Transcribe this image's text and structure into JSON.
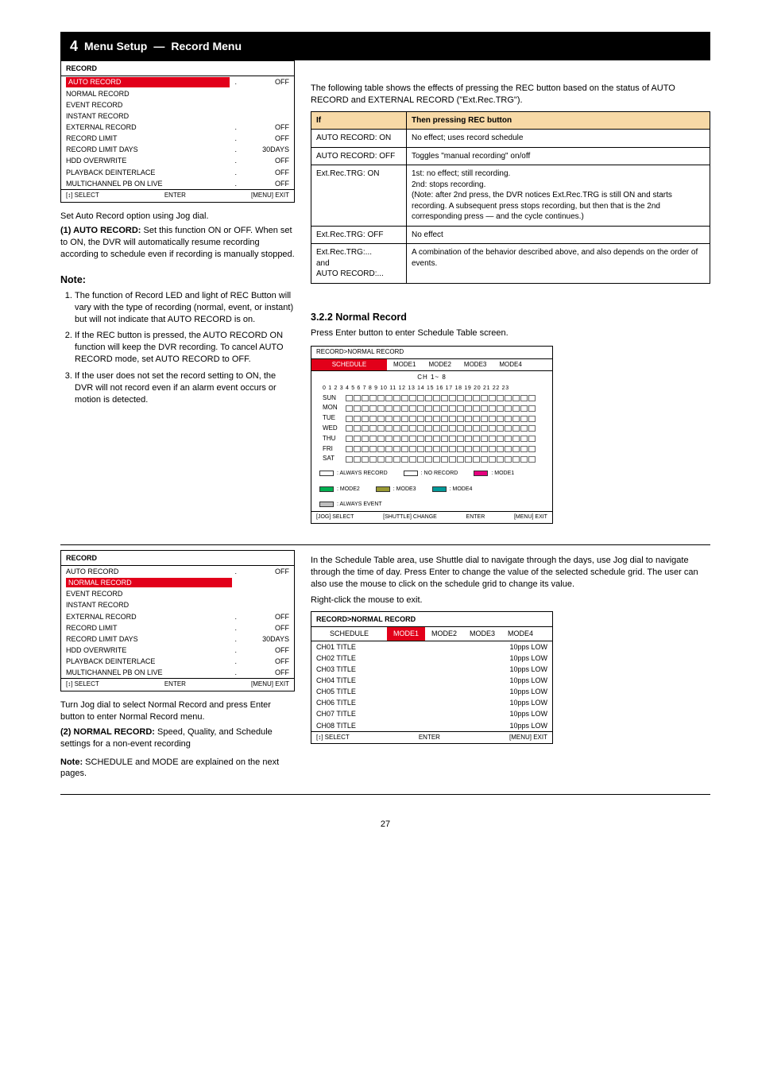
{
  "header": {
    "num": "4",
    "title": "Menu Setup",
    "sub": "Record Menu"
  },
  "autoMenu": {
    "title": "RECORD",
    "items": [
      {
        "label": "AUTO RECORD",
        "val": "OFF"
      },
      {
        "label": "NORMAL RECORD",
        "val": ""
      },
      {
        "label": "EVENT RECORD",
        "val": ""
      },
      {
        "label": "INSTANT RECORD",
        "val": ""
      },
      {
        "label": "EXTERNAL RECORD",
        "val": "OFF"
      },
      {
        "label": "RECORD LIMIT",
        "val": "OFF"
      },
      {
        "label": "RECORD LIMIT DAYS",
        "val": "30DAYS"
      },
      {
        "label": "HDD OVERWRITE",
        "val": "OFF"
      },
      {
        "label": "PLAYBACK DEINTERLACE",
        "val": "OFF"
      },
      {
        "label": "MULTICHANNEL PB ON LIVE",
        "val": "OFF"
      }
    ],
    "footer": {
      "sel": "[↕] SELECT",
      "enter": "ENTER",
      "exit": "[MENU] EXIT"
    }
  },
  "autoRecordIntro": "Set Auto Record option using Jog dial.",
  "autoRecordLabel": "(1) AUTO RECORD:",
  "autoRecordBodyFinish": " Set this function ON or OFF. When set to ON, the DVR will automatically resume recording according to schedule even if recording is manually stopped.",
  "noteHead": "Note:",
  "autoNotes": [
    "The function of Record LED and light of REC Button will vary with the type of recording (normal, event, or instant) but will not indicate that AUTO RECORD is on.",
    "If the REC button is pressed, the AUTO RECORD ON function will keep the DVR recording. To cancel AUTO RECORD mode, set AUTO RECORD to OFF.",
    "If the user does not set the record setting to ON, the DVR will not record even if an alarm event occurs or motion is detected."
  ],
  "effectsHead": "The following table shows the effects of pressing the REC button based on the status of AUTO RECORD and EXTERNAL RECORD (\"Ext.Rec.TRG\").",
  "table": {
    "headers": [
      "If",
      "Then pressing REC button"
    ],
    "rows": [
      [
        "AUTO RECORD: ON",
        "No effect; uses record schedule"
      ],
      [
        "AUTO RECORD: OFF",
        "Toggles \"manual recording\" on/off"
      ],
      [
        "Ext.Rec.TRG: ON",
        "1st: no effect; still recording.\n2nd: stops recording.\n(Note: after 2nd press, the DVR notices Ext.Rec.TRG is still ON and starts recording. A subsequent press stops recording, but then that is the 2nd corresponding press — and the cycle continues.)"
      ],
      [
        "Ext.Rec.TRG: OFF",
        "No effect"
      ],
      [
        "Ext.Rec.TRG:...\nand\nAUTO RECORD:...",
        "A combination of the behavior described above, and also depends on the order of events."
      ]
    ]
  },
  "section322": "3.2.2 Normal Record",
  "pressEnterSchedule": "Press Enter button to enter Schedule Table screen.",
  "schedule": {
    "title": "RECORD>NORMAL RECORD",
    "tabs": [
      "SCHEDULE",
      "MODE1",
      "MODE2",
      "MODE3",
      "MODE4"
    ],
    "chan": "CH 1~ 8",
    "hours": "0  1  2  3  4  5  6  7  8  9  10  11  12  13  14  15  16  17  18  19  20  21  22  23",
    "days": [
      "SUN",
      "MON",
      "TUE",
      "WED",
      "THU",
      "FRI",
      "SAT"
    ],
    "legend": [
      {
        "cls": "full-outline",
        "txt": ": ALWAYS RECORD"
      },
      {
        "cls": "white",
        "txt": ": NO RECORD"
      },
      {
        "cls": "magenta",
        "txt": ": MODE1"
      },
      {
        "cls": "green",
        "txt": ": MODE2"
      },
      {
        "cls": "olive",
        "txt": ": MODE3"
      },
      {
        "cls": "teal",
        "txt": ": MODE4"
      },
      {
        "cls": "grey",
        "txt": ": ALWAYS EVENT"
      }
    ],
    "footer": {
      "jog": "[JOG] SELECT",
      "shuttle": "[SHUTTLE] CHANGE",
      "enter": "ENTER",
      "exit": "[MENU] EXIT"
    }
  },
  "normalMenu": {
    "title": "RECORD",
    "items": [
      {
        "label": "AUTO RECORD",
        "val": "OFF"
      },
      {
        "label": "NORMAL RECORD",
        "val": ""
      },
      {
        "label": "EVENT RECORD",
        "val": ""
      },
      {
        "label": "INSTANT RECORD",
        "val": ""
      },
      {
        "label": "EXTERNAL RECORD",
        "val": "OFF"
      },
      {
        "label": "RECORD LIMIT",
        "val": "OFF"
      },
      {
        "label": "RECORD LIMIT DAYS",
        "val": "30DAYS"
      },
      {
        "label": "HDD OVERWRITE",
        "val": "OFF"
      },
      {
        "label": "PLAYBACK DEINTERLACE",
        "val": "OFF"
      },
      {
        "label": "MULTICHANNEL PB ON LIVE",
        "val": "OFF"
      }
    ],
    "footer": {
      "sel": "[↕] SELECT",
      "enter": "ENTER",
      "exit": "[MENU] EXIT"
    }
  },
  "normalRecordIntro": "Turn Jog dial to select Normal Record and press Enter button to enter Normal Record menu.",
  "normalRecordLabel": "(2) NORMAL RECORD:",
  "normalRecordBodyFinish": " Speed, Quality, and Schedule settings for a non-event recording",
  "scheduleModeNoteHead": "Note:",
  "scheduleModeNote": "SCHEDULE and MODE are explained on the next pages.",
  "rightNarrative": [
    "In the Schedule Table area, use Shuttle dial to navigate through the days, use Jog dial to navigate through the time of day. Press Enter to change the value of the selected schedule grid. The user can also use the mouse to click on the schedule grid to change its value.",
    "Right-click the mouse to exit."
  ],
  "modeMenu": {
    "title": "RECORD>NORMAL RECORD",
    "tabs": [
      "SCHEDULE",
      "MODE1",
      "MODE2",
      "MODE3",
      "MODE4"
    ],
    "rows": [
      {
        "label": "CH01 TITLE",
        "val": "10pps LOW"
      },
      {
        "label": "CH02 TITLE",
        "val": "10pps LOW"
      },
      {
        "label": "CH03 TITLE",
        "val": "10pps LOW"
      },
      {
        "label": "CH04 TITLE",
        "val": "10pps LOW"
      },
      {
        "label": "CH05 TITLE",
        "val": "10pps LOW"
      },
      {
        "label": "CH06 TITLE",
        "val": "10pps LOW"
      },
      {
        "label": "CH07 TITLE",
        "val": "10pps LOW"
      },
      {
        "label": "CH08 TITLE",
        "val": "10pps LOW"
      }
    ],
    "footer": {
      "sel": "[↕] SELECT",
      "enter": "ENTER",
      "exit": "[MENU] EXIT"
    }
  },
  "page": "27"
}
